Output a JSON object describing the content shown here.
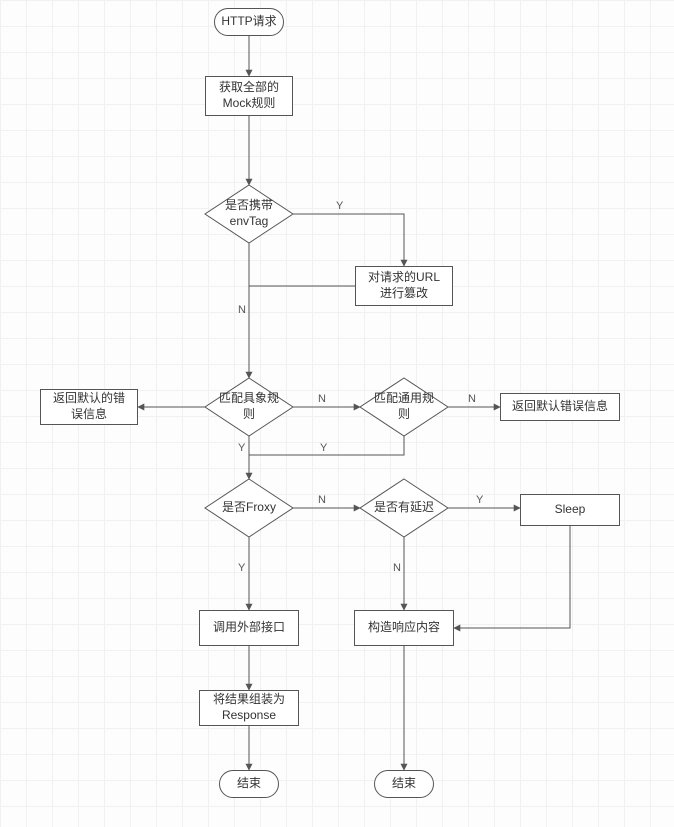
{
  "nodes": {
    "start": "HTTP请求",
    "getRules": "获取全部的\nMock规则",
    "hasEnvTag": "是否携带\nenvTag",
    "tamperUrl": "对请求的URL\n进行篡改",
    "matchConcrete": "匹配具象规\n则",
    "matchGeneric": "匹配通用规\n则",
    "defaultErr1": "返回默认的错\n误信息",
    "defaultErr2": "返回默认错误信息",
    "isFroxy": "是否Froxy",
    "hasDelay": "是否有延迟",
    "sleep": "Sleep",
    "callExternal": "调用外部接口",
    "buildResp": "构造响应内容",
    "assemble": "将结果组装为\nResponse",
    "end1": "结束",
    "end2": "结束"
  },
  "edges": {
    "Y": "Y",
    "N": "N"
  }
}
